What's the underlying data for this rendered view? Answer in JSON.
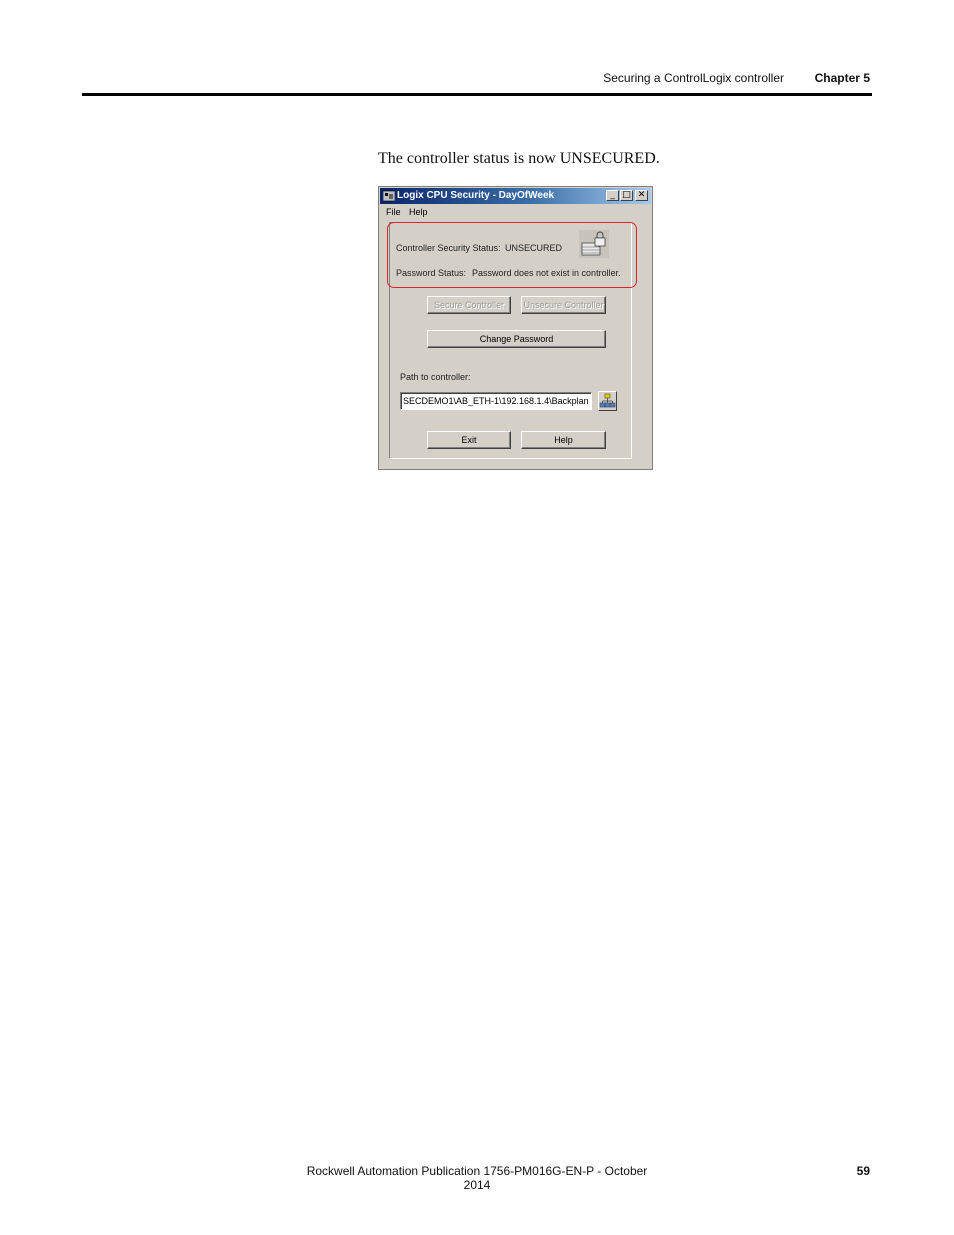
{
  "header": {
    "section_title": "Securing a ControlLogix controller",
    "chapter": "Chapter 5"
  },
  "caption": "The controller status is now UNSECURED.",
  "dialog": {
    "title": "Logix CPU Security - DayOfWeek",
    "window_controls": {
      "minimize": "_",
      "maximize": "□",
      "close": "✕"
    },
    "menu": [
      "File",
      "Help"
    ],
    "security_status_label": "Controller Security Status:",
    "security_status_value": "UNSECURED",
    "password_status_label": "Password Status:",
    "password_status_value": "Password does not exist in controller.",
    "buttons": {
      "secure": "Secure Controller",
      "unsecure": "Unsecure Controller",
      "change_password": "Change Password",
      "exit": "Exit",
      "help": "Help"
    },
    "path_label": "Path to controller:",
    "path_value": "SECDEMO1\\AB_ETH-1\\192.168.1.4\\Backplan",
    "icons": {
      "status": "lock-icon",
      "browse": "network-browse-icon",
      "app": "app-icon"
    },
    "highlight_color": "#e0242b"
  },
  "footer": {
    "publication": "Rockwell Automation Publication 1756-PM016G-EN-P - October 2014",
    "page_number": "59"
  }
}
